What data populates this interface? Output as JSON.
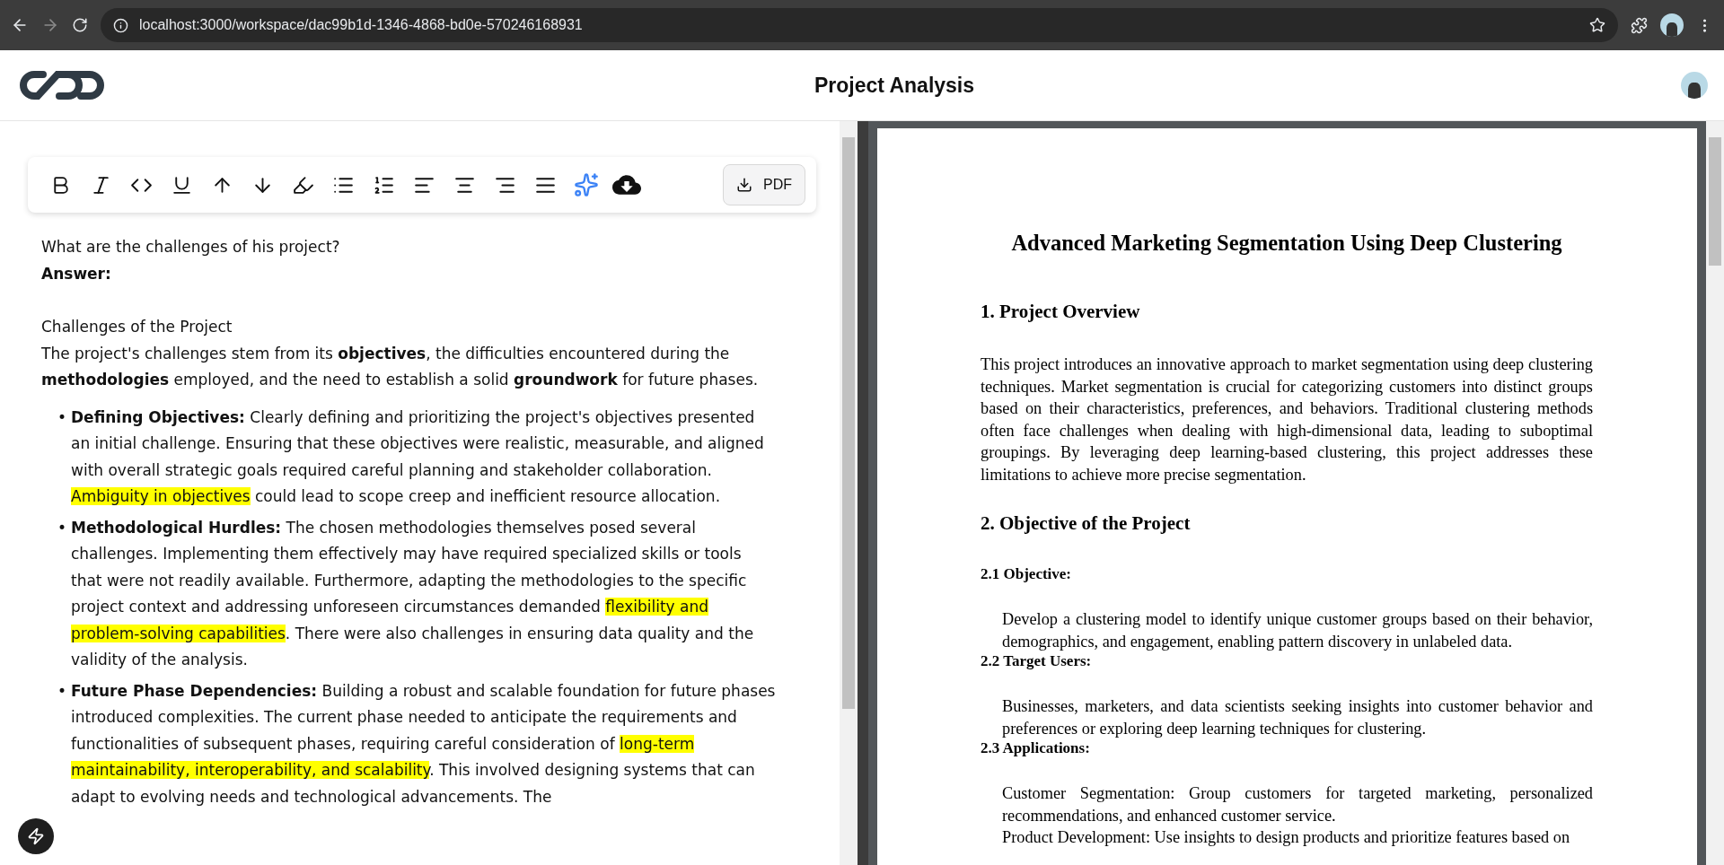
{
  "browser": {
    "url": "localhost:3000/workspace/dac99b1d-1346-4868-bd0e-570246168931"
  },
  "header": {
    "title": "Project Analysis"
  },
  "toolbar": {
    "tools": [
      {
        "kind": "bold"
      },
      {
        "kind": "italic"
      },
      {
        "kind": "code"
      },
      {
        "kind": "underline"
      },
      {
        "kind": "arrow-up"
      },
      {
        "kind": "arrow-down"
      },
      {
        "kind": "highlighter"
      },
      {
        "kind": "bullet-list"
      },
      {
        "kind": "numbered-list"
      },
      {
        "kind": "align-left"
      },
      {
        "kind": "align-center"
      },
      {
        "kind": "align-right"
      },
      {
        "kind": "justify"
      },
      {
        "kind": "sparkles"
      },
      {
        "kind": "cloud-download"
      }
    ],
    "pdf_button": {
      "label": "PDF"
    }
  },
  "editor": {
    "question": "What are the challenges of his project?",
    "answer_label": "Answer:",
    "heading": "Challenges of the Project",
    "intro": [
      {
        "kind": "plain",
        "text": "The project's challenges stem from its "
      },
      {
        "kind": "bold",
        "text": "objectives"
      },
      {
        "kind": "plain",
        "text": ", the difficulties encountered during the "
      },
      {
        "kind": "bold",
        "text": "methodologies"
      },
      {
        "kind": "plain",
        "text": " employed, and the need to establish a solid "
      },
      {
        "kind": "bold",
        "text": "groundwork"
      },
      {
        "kind": "plain",
        "text": " for future phases."
      }
    ],
    "bullets": [
      {
        "marker": "•",
        "segments": [
          {
            "kind": "bold",
            "text": "Defining Objectives:"
          },
          {
            "kind": "plain",
            "text": " Clearly defining and prioritizing the project's objectives presented an initial challenge. Ensuring that these objectives were realistic, measurable, and aligned with overall strategic goals required careful planning and stakeholder collaboration. "
          },
          {
            "kind": "highlight",
            "text": "Ambiguity in objectives"
          },
          {
            "kind": "plain",
            "text": " could lead to scope creep and inefficient resource allocation."
          }
        ]
      },
      {
        "marker": "•",
        "segments": [
          {
            "kind": "bold",
            "text": "Methodological Hurdles:"
          },
          {
            "kind": "plain",
            "text": " The chosen methodologies themselves posed several challenges. Implementing them effectively may have required specialized skills or tools that were not readily available. Furthermore, adapting the methodologies to the specific project context and addressing unforeseen circumstances demanded "
          },
          {
            "kind": "highlight",
            "text": "flexibility and problem-solving capabilities"
          },
          {
            "kind": "plain",
            "text": ". There were also challenges in ensuring data quality and the validity of the analysis."
          }
        ]
      },
      {
        "marker": "•",
        "segments": [
          {
            "kind": "bold",
            "text": "Future Phase Dependencies:"
          },
          {
            "kind": "plain",
            "text": " Building a robust and scalable foundation for future phases introduced complexities. The current phase needed to anticipate the requirements and functionalities of subsequent phases, requiring careful consideration of "
          },
          {
            "kind": "highlight",
            "text": "long-term maintainability, interoperability, and scalability"
          },
          {
            "kind": "plain",
            "text": ". This involved designing systems that can adapt to evolving needs and technological advancements. The"
          }
        ]
      }
    ]
  },
  "pdf": {
    "title": "Advanced Marketing Segmentation Using Deep Clustering",
    "blocks": [
      {
        "kind": "h1",
        "text": "1. Project Overview"
      },
      {
        "kind": "para",
        "text": "This project introduces an innovative approach to market segmentation using deep clustering techniques. Market segmentation is crucial for categorizing customers into distinct groups based on their characteristics, preferences, and behaviors. Traditional clustering methods often face challenges when dealing with high-dimensional data, leading to suboptimal groupings. By leveraging deep learning-based clustering, this project addresses these limitations to achieve more precise segmentation."
      },
      {
        "kind": "h1",
        "text": "2. Objective of the Project"
      },
      {
        "kind": "h2",
        "text": "2.1 Objective:"
      },
      {
        "kind": "indent",
        "text": "Develop a clustering model to identify unique customer groups based on their behavior, demographics, and engagement, enabling pattern discovery in unlabeled data."
      },
      {
        "kind": "h2",
        "text": "2.2 Target Users:"
      },
      {
        "kind": "indent",
        "text": "Businesses, marketers, and data scientists seeking insights into customer behavior and preferences or exploring deep learning techniques for clustering."
      },
      {
        "kind": "h2",
        "text": "2.3 Applications:"
      },
      {
        "kind": "indent",
        "text": "Customer Segmentation: Group customers for targeted marketing, personalized recommendations, and enhanced customer service."
      },
      {
        "kind": "indent",
        "text": "Product Development: Use insights to design products and prioritize features based on"
      }
    ]
  }
}
